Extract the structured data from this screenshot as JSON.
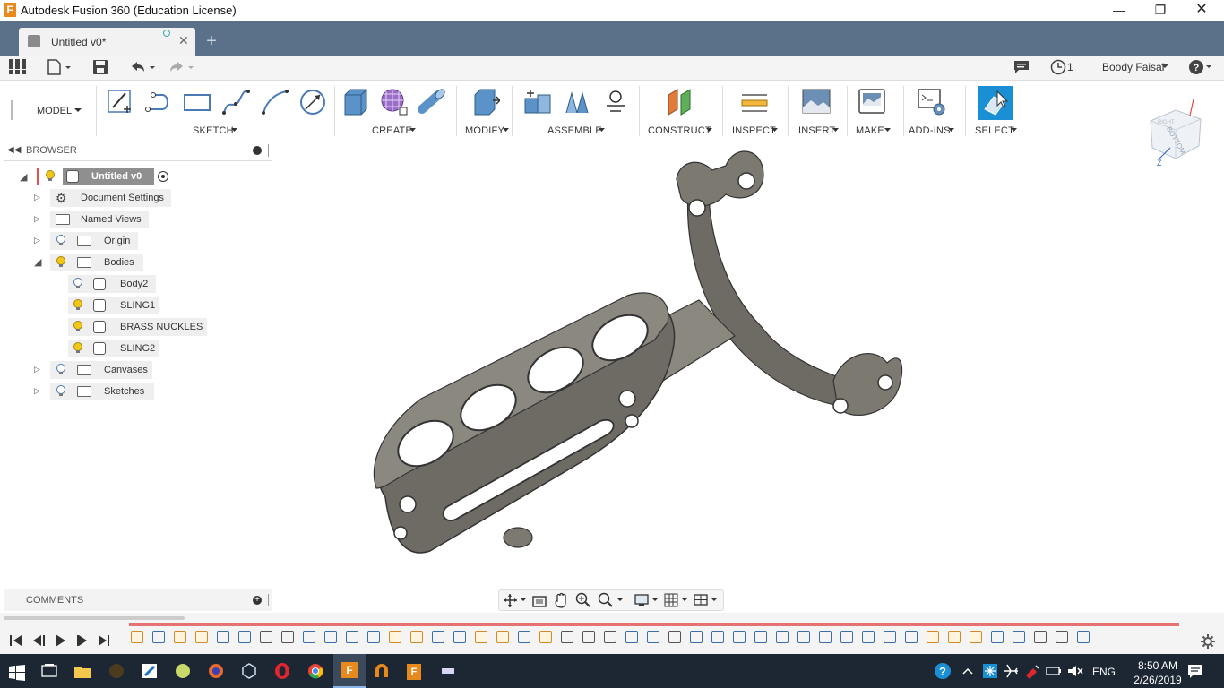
{
  "window": {
    "title": "Autodesk Fusion 360 (Education License)"
  },
  "tab": {
    "label": "Untitled v0*"
  },
  "quick_access": {
    "job_count": "1",
    "user": "Boody Faisal"
  },
  "workspace": {
    "label": "MODEL"
  },
  "ribbon": {
    "groups": [
      "SKETCH",
      "CREATE",
      "MODIFY",
      "ASSEMBLE",
      "CONSTRUCT",
      "INSPECT",
      "INSERT",
      "MAKE",
      "ADD-INS",
      "SELECT"
    ]
  },
  "viewcube": {
    "face": "BOTTOM",
    "axis_z": "Z",
    "corner": "RIGHT"
  },
  "browser": {
    "title": "BROWSER",
    "root": "Untitled v0",
    "items": [
      {
        "label": "Document Settings"
      },
      {
        "label": "Named Views"
      },
      {
        "label": "Origin"
      },
      {
        "label": "Bodies"
      },
      {
        "label": "Body2"
      },
      {
        "label": "SLING1"
      },
      {
        "label": "BRASS NUCKLES"
      },
      {
        "label": "SLING2"
      },
      {
        "label": "Canvases"
      },
      {
        "label": "Sketches"
      }
    ]
  },
  "comments": {
    "title": "COMMENTS"
  },
  "taskbar": {
    "lang": "ENG",
    "time": "8:50 AM",
    "date": "2/26/2019"
  },
  "colors": {
    "tabbar": "#5b7189",
    "select_active": "#1b8fd3",
    "taskbar": "#1c2733",
    "model": "#7a7770"
  }
}
